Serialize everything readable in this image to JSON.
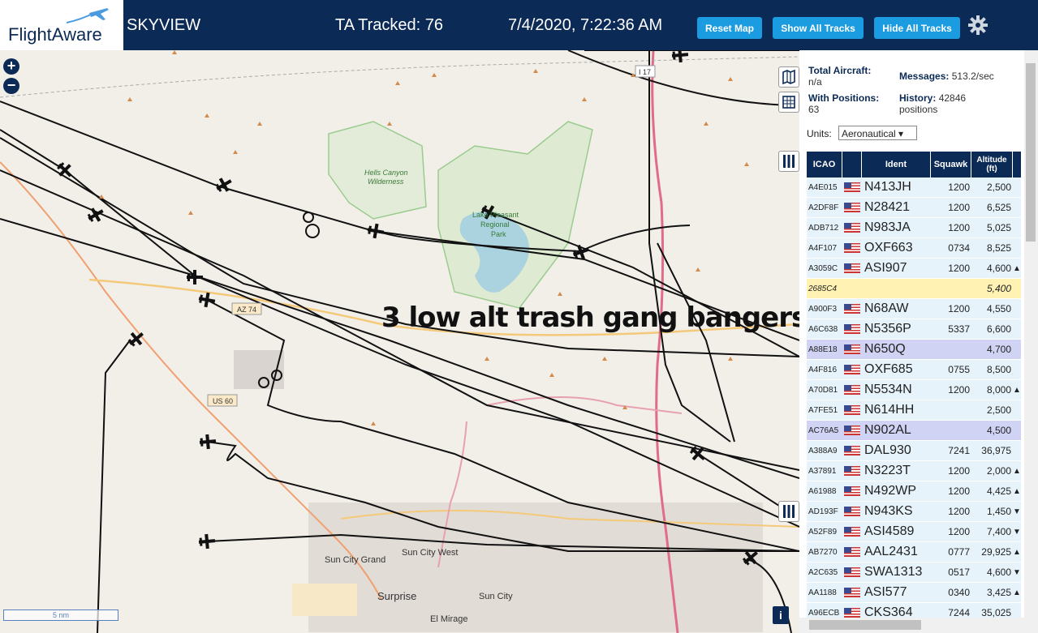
{
  "header": {
    "logo_text": "FlightAware",
    "app_name": "SKYVIEW",
    "tracked": "TA Tracked: 76",
    "datetime": "7/4/2020, 7:22:36 AM",
    "reset_label": "Reset Map",
    "show_label": "Show All Tracks",
    "hide_label": "Hide All Tracks"
  },
  "map": {
    "zoom_in": "+",
    "zoom_out": "−",
    "annotation": "3 low alt trash gang bangers",
    "scale": "5 nm",
    "info": "i",
    "labels": {
      "hells": "Hells Canyon",
      "wild": "Wilderness",
      "lake1": "Lake Pleasant",
      "lake2": "Regional",
      "lake3": "Park",
      "az74": "AZ 74",
      "us60": "US 60",
      "i17": "I 17",
      "scg": "Sun City Grand",
      "scw": "Sun City West",
      "sc": "Sun City",
      "surprise": "Surprise",
      "elmirage": "El Mirage"
    }
  },
  "panel": {
    "total_label": "Total Aircraft:",
    "total_value": "n/a",
    "messages_label": "Messages:",
    "messages_value": "513.2/sec",
    "positions_label": "With Positions:",
    "positions_value": "63",
    "history_label": "History:",
    "history_value": "42846",
    "history_unit": "positions",
    "units_label": "Units:",
    "units_value": "Aeronautical ▾",
    "columns": {
      "icao": "ICAO",
      "ident": "Ident",
      "squawk": "Squawk",
      "alt1": "Altitude",
      "alt2": "(ft)"
    }
  },
  "rows": [
    {
      "icao": "A4E015",
      "ident": "N413JH",
      "squawk": "1200",
      "alt": "2,500",
      "trend": ""
    },
    {
      "icao": "A2DF8F",
      "ident": "N28421",
      "squawk": "1200",
      "alt": "6,525",
      "trend": ""
    },
    {
      "icao": "ADB712",
      "ident": "N983JA",
      "squawk": "1200",
      "alt": "5,025",
      "trend": ""
    },
    {
      "icao": "A4F107",
      "ident": "OXF663",
      "squawk": "0734",
      "alt": "8,525",
      "trend": ""
    },
    {
      "icao": "A3059C",
      "ident": "ASI907",
      "squawk": "1200",
      "alt": "4,600",
      "trend": "▲"
    },
    {
      "icao": "2685C4",
      "ident": "",
      "squawk": "",
      "alt": "5,400",
      "trend": ""
    },
    {
      "icao": "A900F3",
      "ident": "N68AW",
      "squawk": "1200",
      "alt": "4,550",
      "trend": ""
    },
    {
      "icao": "A6C638",
      "ident": "N5356P",
      "squawk": "5337",
      "alt": "6,600",
      "trend": ""
    },
    {
      "icao": "A88E18",
      "ident": "N650Q",
      "squawk": "",
      "alt": "4,700",
      "trend": ""
    },
    {
      "icao": "A4F816",
      "ident": "OXF685",
      "squawk": "0755",
      "alt": "8,500",
      "trend": ""
    },
    {
      "icao": "A70D81",
      "ident": "N5534N",
      "squawk": "1200",
      "alt": "8,000",
      "trend": "▲"
    },
    {
      "icao": "A7FE51",
      "ident": "N614HH",
      "squawk": "",
      "alt": "2,500",
      "trend": ""
    },
    {
      "icao": "AC76A5",
      "ident": "N902AL",
      "squawk": "",
      "alt": "4,500",
      "trend": ""
    },
    {
      "icao": "A388A9",
      "ident": "DAL930",
      "squawk": "7241",
      "alt": "36,975",
      "trend": ""
    },
    {
      "icao": "A37891",
      "ident": "N3223T",
      "squawk": "1200",
      "alt": "2,000",
      "trend": "▲"
    },
    {
      "icao": "A61988",
      "ident": "N492WP",
      "squawk": "1200",
      "alt": "4,425",
      "trend": "▲"
    },
    {
      "icao": "AD193F",
      "ident": "N943KS",
      "squawk": "1200",
      "alt": "1,450",
      "trend": "▼"
    },
    {
      "icao": "A52F89",
      "ident": "ASI4589",
      "squawk": "1200",
      "alt": "7,400",
      "trend": "▼"
    },
    {
      "icao": "AB7270",
      "ident": "AAL2431",
      "squawk": "0777",
      "alt": "29,925",
      "trend": "▲"
    },
    {
      "icao": "A2C635",
      "ident": "SWA1313",
      "squawk": "0517",
      "alt": "4,600",
      "trend": "▼"
    },
    {
      "icao": "AA1188",
      "ident": "ASI577",
      "squawk": "0340",
      "alt": "3,425",
      "trend": "▲"
    },
    {
      "icao": "A96ECB",
      "ident": "CKS364",
      "squawk": "7244",
      "alt": "35,025",
      "trend": ""
    }
  ]
}
